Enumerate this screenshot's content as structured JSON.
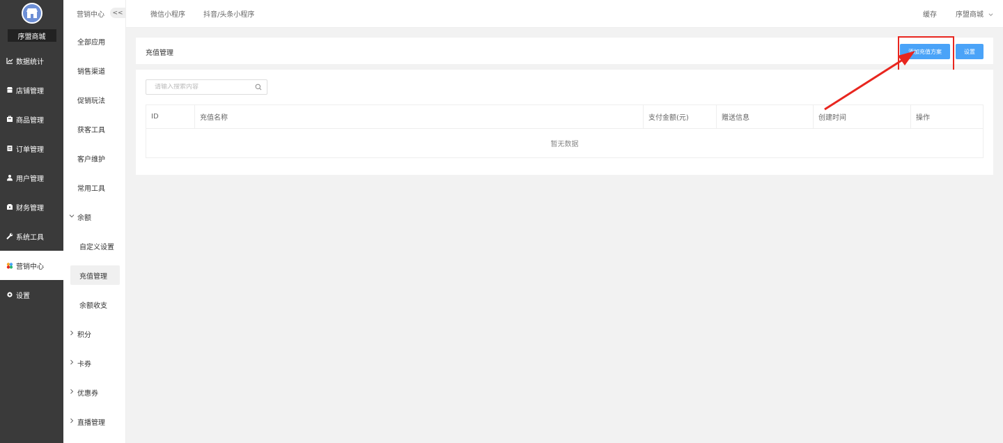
{
  "sidebar": {
    "shop_name": "序盟商城",
    "items": [
      {
        "label": "数据统计",
        "icon": "chart-icon"
      },
      {
        "label": "店铺管理",
        "icon": "store-icon"
      },
      {
        "label": "商品管理",
        "icon": "goods-icon"
      },
      {
        "label": "订单管理",
        "icon": "order-icon"
      },
      {
        "label": "用户管理",
        "icon": "user-icon"
      },
      {
        "label": "财务管理",
        "icon": "finance-icon"
      },
      {
        "label": "系统工具",
        "icon": "wrench-icon"
      },
      {
        "label": "营销中心",
        "icon": "marketing-icon"
      },
      {
        "label": "设置",
        "icon": "gear-icon"
      }
    ]
  },
  "sub_sidebar": {
    "title": "营销中心",
    "collapse": "<<",
    "items": [
      "全部应用",
      "销售渠道",
      "促销玩法",
      "获客工具",
      "客户维护",
      "常用工具"
    ],
    "balance_group": "余额",
    "balance_children": [
      "自定义设置",
      "充值管理",
      "余额收支"
    ],
    "groups": [
      "积分",
      "卡券",
      "优惠券",
      "直播管理"
    ]
  },
  "topbar": {
    "tabs": [
      "微信小程序",
      "抖音/头条小程序"
    ],
    "cache": "缓存",
    "account": "序盟商城"
  },
  "header": {
    "title": "充值管理",
    "add_button": "添加充值方案",
    "settings_button": "设置"
  },
  "search": {
    "placeholder": "请输入搜索内容"
  },
  "table": {
    "columns": [
      "ID",
      "充值名称",
      "支付金额(元)",
      "赠送信息",
      "创建时间",
      "操作"
    ],
    "empty_text": "暂无数据"
  },
  "colors": {
    "accent": "#4aa3f8",
    "annotation": "#e8261f",
    "sidebar_bg": "#3a3a3a"
  }
}
